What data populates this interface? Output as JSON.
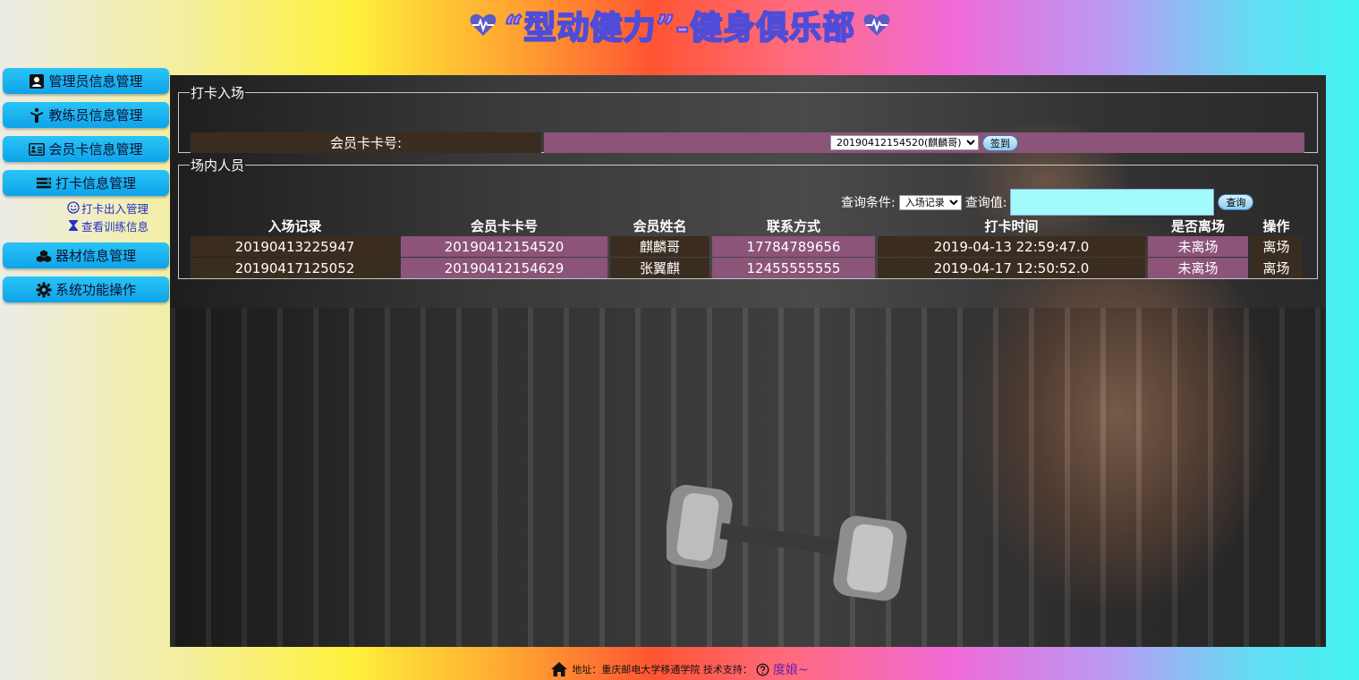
{
  "header": {
    "title": "“型动健力”-健身俱乐部",
    "icon_left": "heartbeat-icon",
    "icon_right": "heartbeat-icon"
  },
  "sidebar": {
    "items": [
      {
        "label": "管理员信息管理",
        "icon": "user-icon"
      },
      {
        "label": "教练员信息管理",
        "icon": "trainer-icon"
      },
      {
        "label": "会员卡信息管理",
        "icon": "id-card-icon"
      },
      {
        "label": "打卡信息管理",
        "icon": "tasks-icon"
      },
      {
        "label": "器材信息管理",
        "icon": "cubes-icon"
      },
      {
        "label": "系统功能操作",
        "icon": "gear-icon"
      }
    ],
    "subitems": [
      {
        "label": "打卡出入管理",
        "icon": "smile-icon"
      },
      {
        "label": "查看训练信息",
        "icon": "hourglass-icon"
      }
    ]
  },
  "checkin": {
    "legend": "打卡入场",
    "label": "会员卡卡号:",
    "selected_card": "20190412154520(麒麟哥)",
    "button": "签到"
  },
  "inside": {
    "legend": "场内人员",
    "query_label": "查询条件:",
    "query_option": "入场记录",
    "query_value_label": "查询值:",
    "query_value": "",
    "query_button": "查询",
    "columns": [
      "入场记录",
      "会员卡卡号",
      "会员姓名",
      "联系方式",
      "打卡时间",
      "是否离场",
      "操作"
    ],
    "rows": [
      [
        "20190413225947",
        "20190412154520",
        "麒麟哥",
        "17784789656",
        "2019-04-13 22:59:47.0",
        "未离场",
        "离场"
      ],
      [
        "20190417125052",
        "20190412154629",
        "张翼麒",
        "12455555555",
        "2019-04-17 12:50:52.0",
        "未离场",
        "离场"
      ]
    ]
  },
  "footer": {
    "address": "地址：重庆邮电大学移通学院 技术支持：",
    "link": "度娘~",
    "home_icon": "home-icon",
    "help_icon": "question-circle-icon"
  }
}
